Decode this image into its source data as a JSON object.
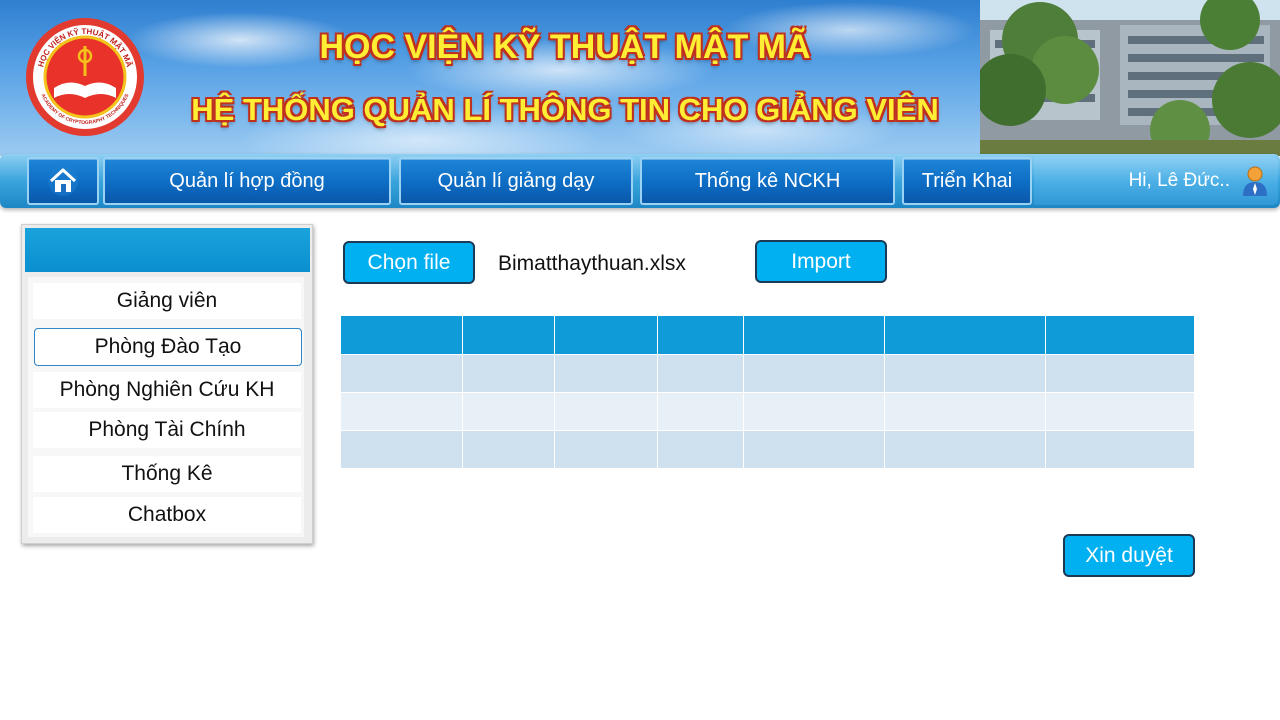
{
  "banner": {
    "title": "HỌC VIỆN KỸ THUẬT MẬT MÃ",
    "subtitle": "HỆ THỐNG QUẢN LÍ THÔNG TIN CHO GIẢNG VIÊN",
    "logo_text_top": "HỌC VIỆN KỸ THUẬT MẬT MÃ",
    "logo_text_bottom": "ACADEMY OF CRYPTOGRAPHY TECHNIQUES"
  },
  "nav": {
    "home_icon": "home-icon",
    "items": [
      {
        "label": "Quản lí hợp đồng"
      },
      {
        "label": "Quản lí giảng dạy"
      },
      {
        "label": "Thống kê NCKH"
      },
      {
        "label": "Triển Khai"
      }
    ],
    "greeting": "Hi, Lê Đức..",
    "user_icon": "user-icon"
  },
  "sidebar": {
    "items": [
      {
        "label": "Giảng viên"
      },
      {
        "label": "Phòng Đào Tạo",
        "active": true
      },
      {
        "label": "Phòng Nghiên Cứu KH"
      },
      {
        "label": "Phòng Tài Chính"
      },
      {
        "label": "Thống Kê"
      },
      {
        "label": "Chatbox"
      }
    ]
  },
  "main": {
    "choose_file_label": "Chọn file",
    "file_name": "Bimatthaythuan.xlsx",
    "import_label": "Import",
    "approve_label": "Xin duyệt",
    "table": {
      "column_count": 7,
      "row_count": 3
    }
  },
  "colors": {
    "accent": "#00b0f0",
    "nav_blue": "#0d6cc4",
    "table_header": "#0f9bd7",
    "title_yellow": "#ffee33",
    "title_outline": "#c0301f"
  }
}
